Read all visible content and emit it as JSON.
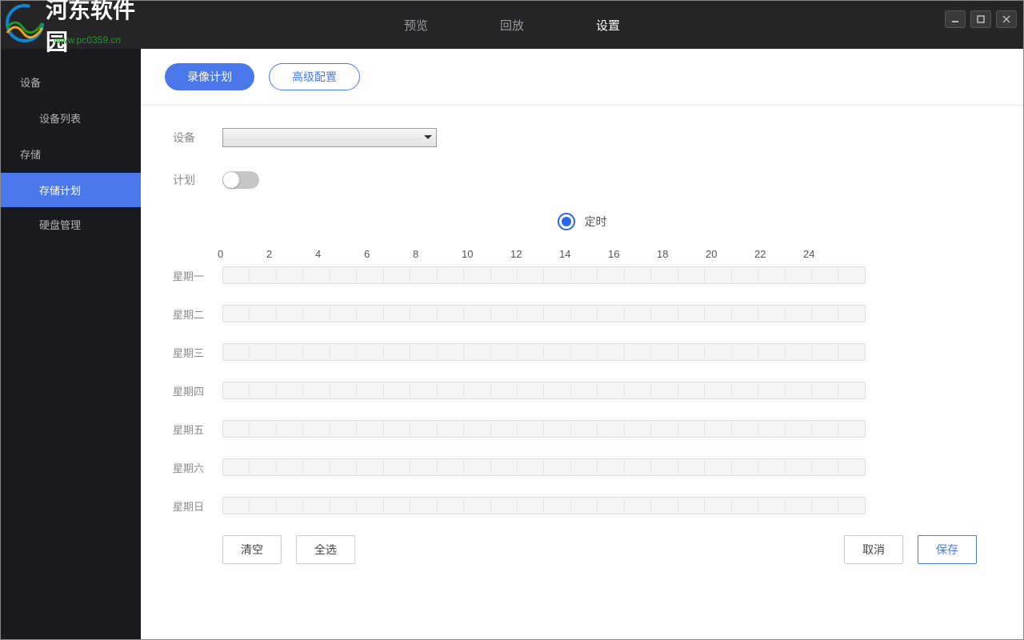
{
  "header": {
    "brand_text": "河东软件园",
    "brand_sub": "www.pc0359.cn",
    "tabs": {
      "preview": "预览",
      "replay": "回放",
      "settings": "设置"
    }
  },
  "sidebar": {
    "devices": "设备",
    "device_list": "设备列表",
    "storage": "存储",
    "storage_plan": "存储计划",
    "disk_mgmt": "硬盘管理"
  },
  "subtabs": {
    "record_plan": "录像计划",
    "advanced": "高级配置"
  },
  "form": {
    "device_label": "设备",
    "plan_label": "计划",
    "timer_label": "定时"
  },
  "hours": [
    "0",
    "2",
    "4",
    "6",
    "8",
    "10",
    "12",
    "14",
    "16",
    "18",
    "20",
    "22",
    "24"
  ],
  "days": [
    "星期一",
    "星期二",
    "星期三",
    "星期四",
    "星期五",
    "星期六",
    "星期日"
  ],
  "buttons": {
    "clear": "清空",
    "select_all": "全选",
    "cancel": "取消",
    "save": "保存"
  }
}
